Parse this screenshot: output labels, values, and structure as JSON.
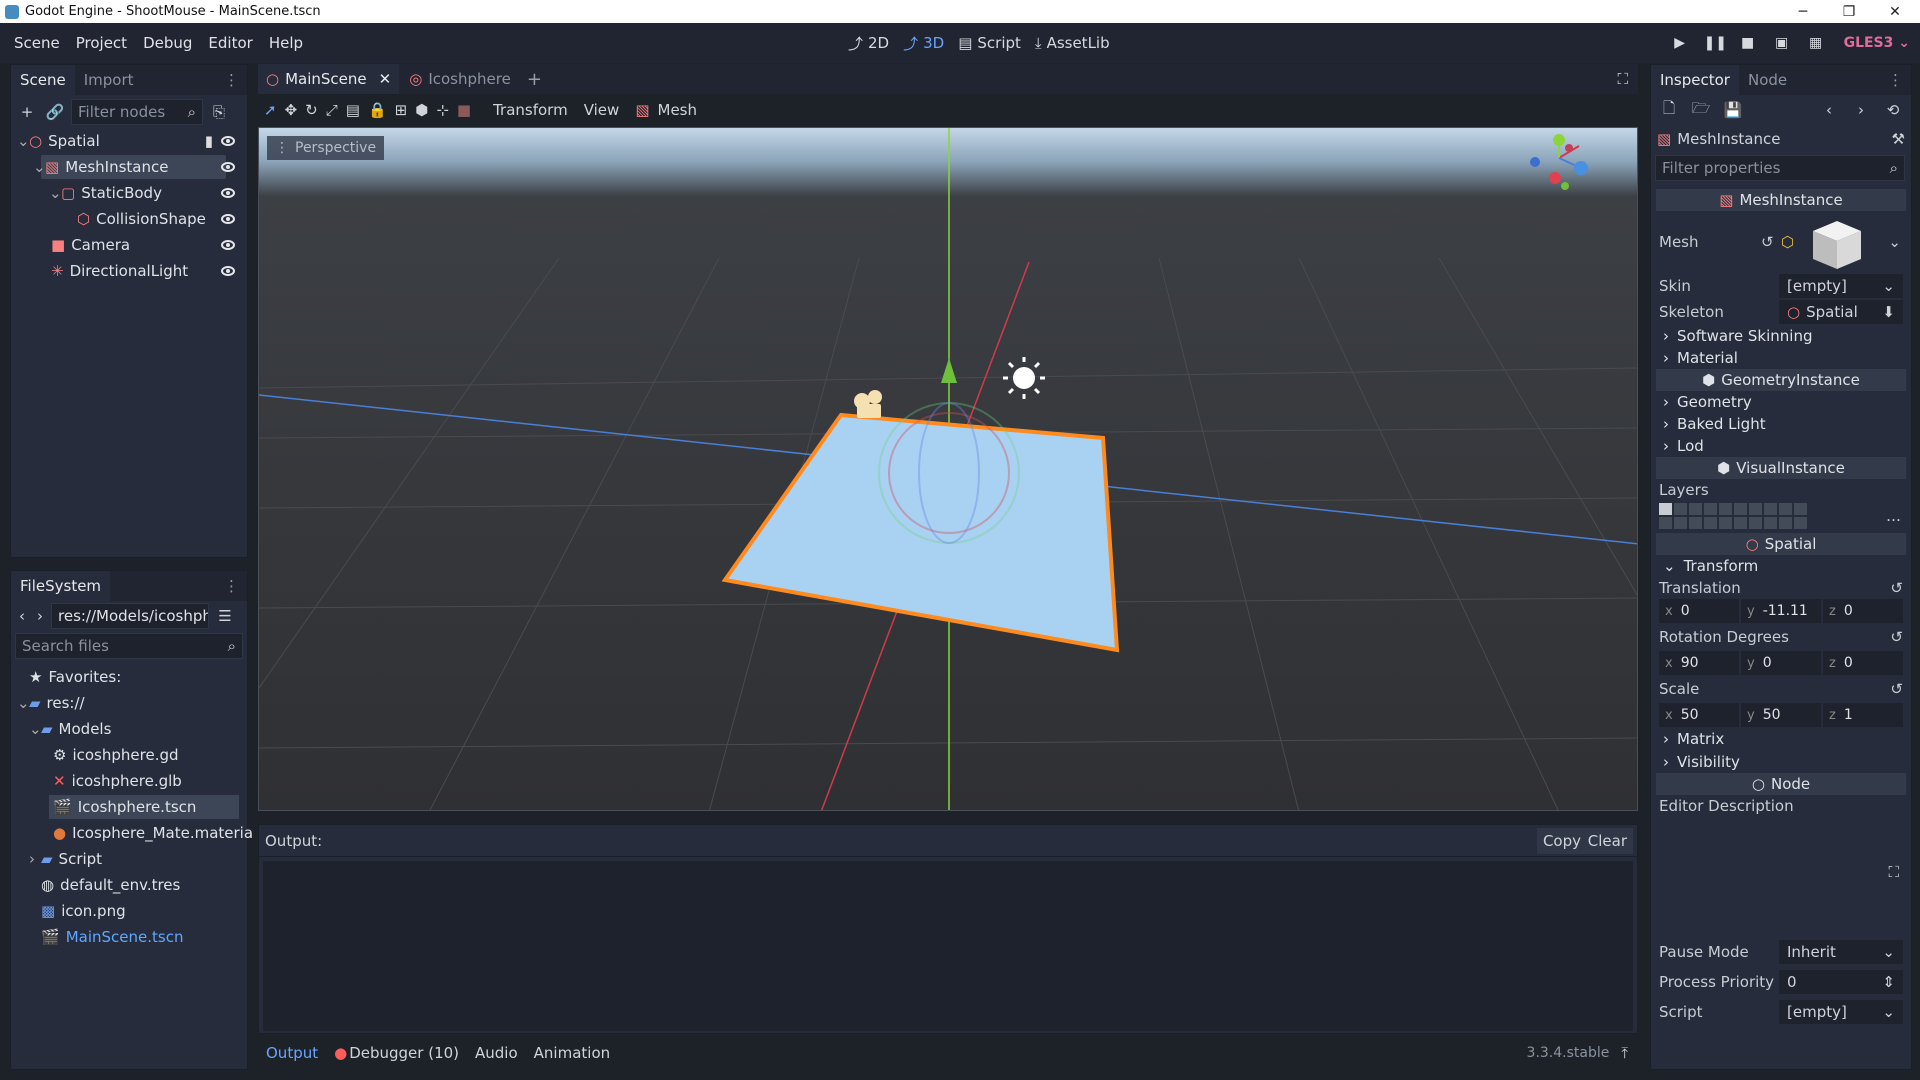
{
  "window": {
    "title": "Godot Engine - ShootMouse - MainScene.tscn"
  },
  "menubar": {
    "items": [
      "Scene",
      "Project",
      "Debug",
      "Editor",
      "Help"
    ]
  },
  "workspaces": [
    {
      "label": "2D",
      "active": false,
      "icon": "2d-icon"
    },
    {
      "label": "3D",
      "active": true,
      "icon": "3d-icon"
    },
    {
      "label": "Script",
      "active": false,
      "icon": "script-icon"
    },
    {
      "label": "AssetLib",
      "active": false,
      "icon": "assetlib-icon"
    }
  ],
  "renderer": "GLES3",
  "scene_dock": {
    "tabs": [
      "Scene",
      "Import"
    ],
    "filter_placeholder": "Filter nodes",
    "tree": [
      {
        "label": "Spatial",
        "icon": "spatial-icon",
        "depth": 0,
        "selected": false
      },
      {
        "label": "MeshInstance",
        "icon": "meshinstance-icon",
        "depth": 1,
        "selected": true
      },
      {
        "label": "StaticBody",
        "icon": "staticbody-icon",
        "depth": 1,
        "selected": false
      },
      {
        "label": "CollisionShape",
        "icon": "collisionshape-icon",
        "depth": 2,
        "selected": false
      },
      {
        "label": "Camera",
        "icon": "camera-icon",
        "depth": 1,
        "selected": false
      },
      {
        "label": "DirectionalLight",
        "icon": "light-icon",
        "depth": 1,
        "selected": false
      }
    ]
  },
  "filesystem_dock": {
    "title": "FileSystem",
    "path": "res://Models/icoshphe",
    "search_placeholder": "Search files",
    "items": [
      {
        "label": "Favorites:",
        "icon": "star-icon",
        "depth": 0
      },
      {
        "label": "res://",
        "icon": "folder-icon",
        "depth": 0
      },
      {
        "label": "Models",
        "icon": "folder-icon",
        "depth": 1
      },
      {
        "label": "icoshphere.gd",
        "icon": "gear-icon",
        "depth": 2
      },
      {
        "label": "icoshphere.glb",
        "icon": "broken-icon",
        "depth": 2
      },
      {
        "label": "Icoshphere.tscn",
        "icon": "scene-file-icon",
        "depth": 2,
        "selected": true
      },
      {
        "label": "Icosphere_Mate.materia",
        "icon": "material-icon",
        "depth": 2
      },
      {
        "label": "Script",
        "icon": "folder-icon",
        "depth": 1
      },
      {
        "label": "default_env.tres",
        "icon": "environment-icon",
        "depth": 1
      },
      {
        "label": "icon.png",
        "icon": "image-icon",
        "depth": 1
      },
      {
        "label": "MainScene.tscn",
        "icon": "scene-file-icon",
        "depth": 1,
        "highlight": true
      }
    ]
  },
  "editor_tabs": [
    "MainScene",
    "Icoshphere"
  ],
  "toolbar3d": {
    "transform": "Transform",
    "view": "View",
    "mesh": "Mesh"
  },
  "viewport": {
    "perspective_label": "Perspective"
  },
  "output": {
    "label": "Output:",
    "copy": "Copy",
    "clear": "Clear",
    "bottom_tabs": [
      "Output",
      "Debugger (10)",
      "Audio",
      "Animation"
    ],
    "version": "3.3.4.stable"
  },
  "inspector": {
    "tabs": [
      "Inspector",
      "Node"
    ],
    "node_name": "MeshInstance",
    "filter_placeholder": "Filter properties",
    "sec_meshinstance": "MeshInstance",
    "mesh_label": "Mesh",
    "skin_label": "Skin",
    "skin_value": "[empty]",
    "skeleton_label": "Skeleton",
    "skeleton_value": "Spatial",
    "software_skinning": "Software Skinning",
    "material": "Material",
    "sec_geometry": "GeometryInstance",
    "geometry": "Geometry",
    "baked_light": "Baked Light",
    "lod": "Lod",
    "sec_visual": "VisualInstance",
    "layers": "Layers",
    "sec_spatial": "Spatial",
    "transform": "Transform",
    "translation_label": "Translation",
    "translation": {
      "x": "0",
      "y": "-11.11",
      "z": "0"
    },
    "rotation_label": "Rotation Degrees",
    "rotation": {
      "x": "90",
      "y": "0",
      "z": "0"
    },
    "scale_label": "Scale",
    "scale": {
      "x": "50",
      "y": "50",
      "z": "1"
    },
    "matrix": "Matrix",
    "visibility": "Visibility",
    "sec_node": "Node",
    "editor_description": "Editor Description",
    "pause_mode_label": "Pause Mode",
    "pause_mode": "Inherit",
    "process_priority_label": "Process Priority",
    "process_priority": "0",
    "script_label": "Script",
    "script_value": "[empty]"
  }
}
